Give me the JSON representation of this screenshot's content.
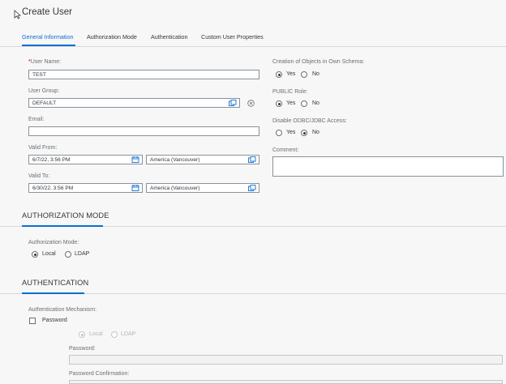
{
  "header": {
    "title": "Create User"
  },
  "tabs": [
    {
      "label": "General Information",
      "active": true
    },
    {
      "label": "Authorization Mode"
    },
    {
      "label": "Authentication"
    },
    {
      "label": "Custom User Properties"
    }
  ],
  "general": {
    "required_marker": "*",
    "user_name": {
      "label": "User Name:",
      "value": "TEST"
    },
    "user_group": {
      "label": "User Group:",
      "value": "DEFAULT"
    },
    "email": {
      "label": "Email:",
      "value": ""
    },
    "valid_from": {
      "label": "Valid From:",
      "date": "6/7/22, 3:56 PM",
      "timezone": "America (Vancouver)"
    },
    "valid_to": {
      "label": "Valid To:",
      "date": "6/30/22, 3:56 PM",
      "timezone": "America (Vancouver)"
    },
    "creation_objects": {
      "label": "Creation of Objects in Own Schema:",
      "yes": "Yes",
      "no": "No",
      "selected": "yes"
    },
    "public_role": {
      "label": "PUBLIC Role:",
      "yes": "Yes",
      "no": "No",
      "selected": "yes"
    },
    "disable_odbc": {
      "label": "Disable ODBC/JDBC Access:",
      "yes": "Yes",
      "no": "No",
      "selected": "no"
    },
    "comment": {
      "label": "Comment:",
      "value": ""
    }
  },
  "authorization_section": {
    "title": "AUTHORIZATION MODE",
    "mode_label": "Authorization Mode:",
    "local": "Local",
    "ldap": "LDAP",
    "selected": "local"
  },
  "authentication_section": {
    "title": "AUTHENTICATION",
    "mechanism_label": "Authentication Mechanism:",
    "password_option": "Password",
    "password_checked": false,
    "local": "Local",
    "ldap": "LDAP",
    "password_label": "Password:",
    "password_confirm_label": "Password Confirmation:"
  },
  "colors": {
    "accent": "#0a6ed1",
    "required": "#bb0000",
    "background": "#f7f7f7"
  },
  "icons": [
    "cursor-arrow-icon",
    "value-help-icon",
    "clear-icon",
    "calendar-icon"
  ]
}
